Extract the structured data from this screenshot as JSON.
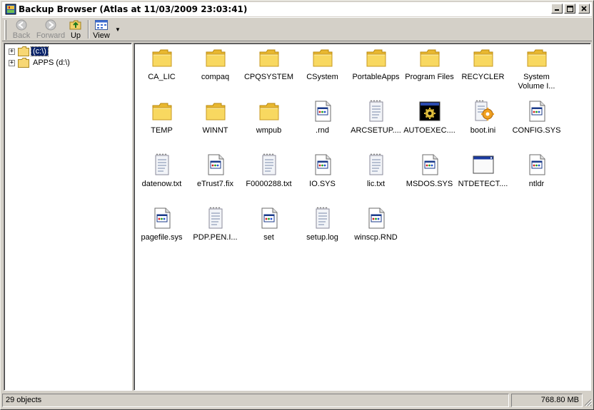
{
  "window": {
    "title": "Backup Browser (Atlas at 11/03/2009 23:03:41)",
    "accent_color": "#0a246a"
  },
  "toolbar": {
    "back_label": "Back",
    "forward_label": "Forward",
    "up_label": "Up",
    "view_label": "View"
  },
  "tree": {
    "items": [
      {
        "label": "(c:\\)",
        "icon": "folder-icon",
        "selected": true
      },
      {
        "label": "APPS (d:\\)",
        "icon": "folder-icon",
        "selected": false
      }
    ]
  },
  "files": [
    {
      "label": "CA_LIC",
      "icon": "folder"
    },
    {
      "label": "compaq",
      "icon": "folder"
    },
    {
      "label": "CPQSYSTEM",
      "icon": "folder"
    },
    {
      "label": "CSystem",
      "icon": "folder"
    },
    {
      "label": "PortableApps",
      "icon": "folder"
    },
    {
      "label": "Program Files",
      "icon": "folder"
    },
    {
      "label": "RECYCLER",
      "icon": "folder"
    },
    {
      "label": "System Volume I...",
      "icon": "folder"
    },
    {
      "label": "TEMP",
      "icon": "folder"
    },
    {
      "label": "WINNT",
      "icon": "folder"
    },
    {
      "label": "wmpub",
      "icon": "folder"
    },
    {
      "label": ".rnd",
      "icon": "generic-file"
    },
    {
      "label": "ARCSETUP....",
      "icon": "text-file"
    },
    {
      "label": "AUTOEXEC....",
      "icon": "batch-file"
    },
    {
      "label": "boot.ini",
      "icon": "settings-file"
    },
    {
      "label": "CONFIG.SYS",
      "icon": "generic-file"
    },
    {
      "label": "datenow.txt",
      "icon": "text-file"
    },
    {
      "label": "eTrust7.fix",
      "icon": "generic-file"
    },
    {
      "label": "F0000288.txt",
      "icon": "text-file"
    },
    {
      "label": "IO.SYS",
      "icon": "generic-file"
    },
    {
      "label": "lic.txt",
      "icon": "text-file"
    },
    {
      "label": "MSDOS.SYS",
      "icon": "generic-file"
    },
    {
      "label": "NTDETECT....",
      "icon": "application-file"
    },
    {
      "label": "ntldr",
      "icon": "generic-file"
    },
    {
      "label": "pagefile.sys",
      "icon": "generic-file"
    },
    {
      "label": "PDP.PEN.I...",
      "icon": "text-file"
    },
    {
      "label": "set",
      "icon": "generic-file"
    },
    {
      "label": "setup.log",
      "icon": "text-file"
    },
    {
      "label": "winscp.RND",
      "icon": "generic-file"
    }
  ],
  "status": {
    "objects": "29 objects",
    "size": "768.80  MB"
  }
}
